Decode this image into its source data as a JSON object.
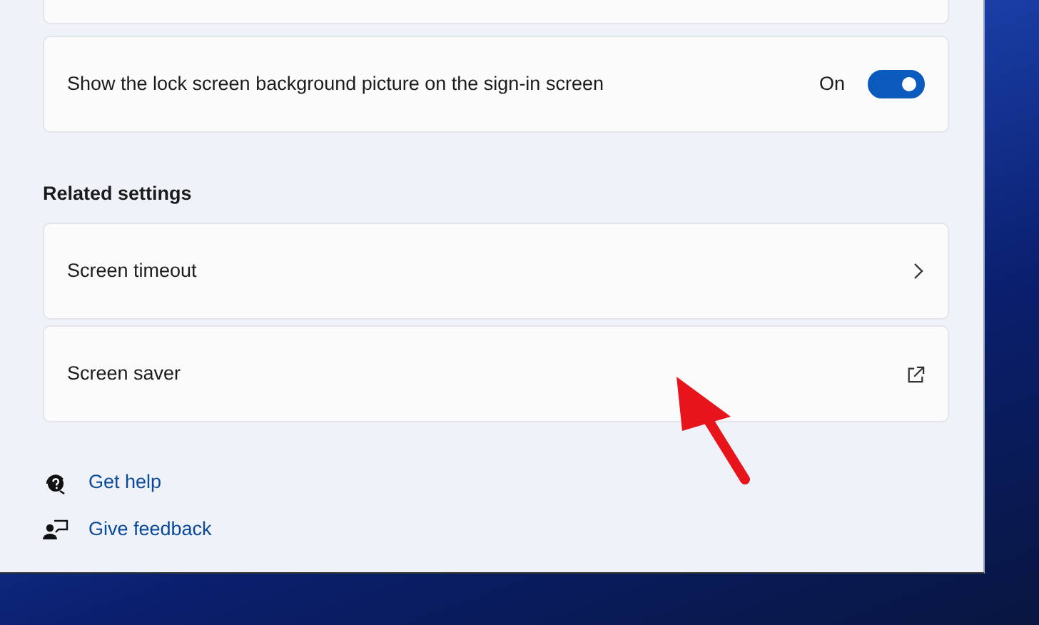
{
  "settings": [
    {
      "kind": "toggle",
      "label": "Show the lock screen background picture on the sign-in screen",
      "state_text": "On",
      "on": true
    }
  ],
  "related_settings": {
    "heading": "Related settings",
    "items": [
      {
        "label": "Screen timeout",
        "kind": "chevron"
      },
      {
        "label": "Screen saver",
        "kind": "external"
      }
    ]
  },
  "links": [
    {
      "label": "Get help",
      "kind": "help"
    },
    {
      "label": "Give feedback",
      "kind": "feedback"
    }
  ]
}
